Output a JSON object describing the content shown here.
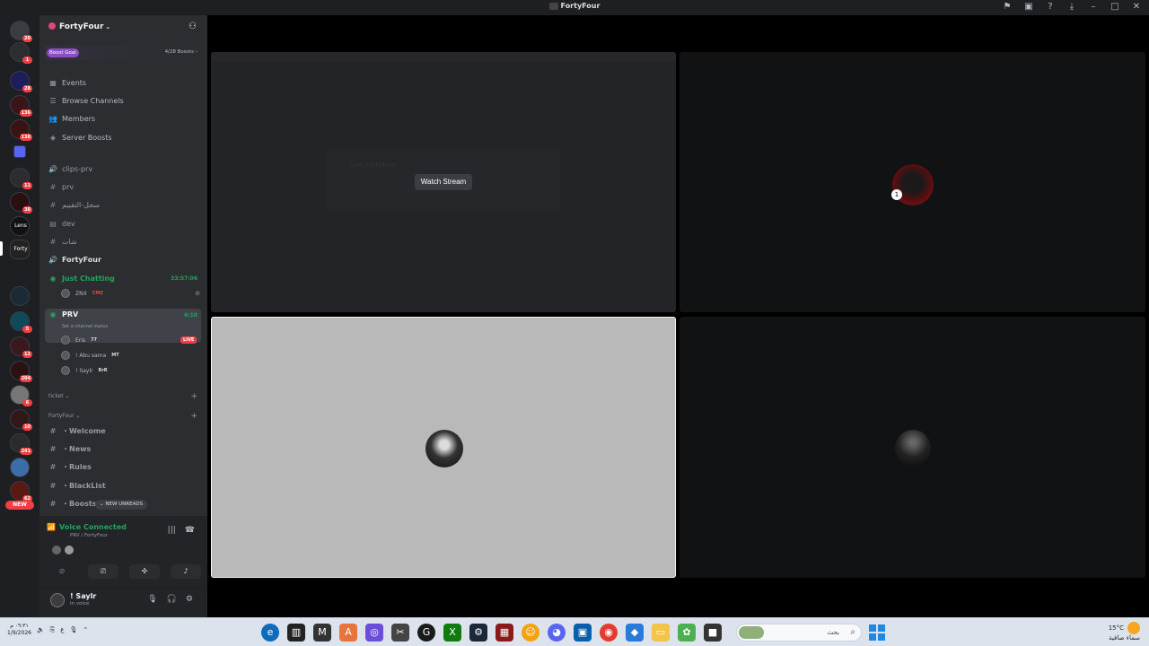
{
  "window": {
    "title": "FortyFour"
  },
  "server": {
    "name": "FortyFour",
    "boost_goal_label": "Boost Goal",
    "boost_count": "4/28 Boosts ›"
  },
  "server_rail": {
    "badges": [
      "20",
      "1",
      "28",
      "136",
      "138",
      "11",
      "38",
      "1",
      "5",
      "12",
      "204",
      "6",
      "10",
      "241",
      "62"
    ],
    "new_label": "NEW",
    "labels": [
      "Lens",
      "Forty"
    ]
  },
  "nav": [
    {
      "label": "Events",
      "icon": "calendar-icon"
    },
    {
      "label": "Browse Channels",
      "icon": "browse-icon"
    },
    {
      "label": "Members",
      "icon": "members-icon"
    },
    {
      "label": "Server Boosts",
      "icon": "boost-icon"
    }
  ],
  "channels": [
    {
      "label": "clips-prv",
      "icon": "speaker-icon"
    },
    {
      "label": "prv",
      "icon": "hash-icon"
    },
    {
      "label": "سجل-التقييم",
      "icon": "hash-icon"
    },
    {
      "label": "dev",
      "icon": "forum-icon"
    },
    {
      "label": "شات",
      "icon": "hash-icon"
    },
    {
      "label": "FortyFour",
      "icon": "speaker-icon"
    }
  ],
  "voice_channels": {
    "just_chatting": {
      "label": "Just Chatting",
      "timer": "33:57:06",
      "users_line": "ZNX",
      "tag": "CMZ"
    },
    "prv": {
      "label": "PRV",
      "timer": "6:10",
      "status": "Set a channel status",
      "users": [
        {
          "name": "Eris",
          "tag": "77",
          "live": "LIVE"
        },
        {
          "name": "! Abu sama",
          "tag": "MT"
        },
        {
          "name": "! Saylr",
          "tag": "RrR"
        }
      ]
    }
  },
  "categories": {
    "ticket": "ticket ⌄",
    "fortyfour": "FortyFour ⌄"
  },
  "text_channels": [
    "・Welcome",
    "・News",
    "・Rules",
    "・BlackList",
    "・Boosts"
  ],
  "new_unreads": "⌄ NEW UNREADS",
  "voice_panel": {
    "status": "Voice Connected",
    "location": "PRV / FortyFour"
  },
  "user": {
    "name": "! Saylr",
    "status": "In voice"
  },
  "stage": {
    "watch_stream_label": "Watch Stream",
    "ghost_title": "Live FortyFour",
    "avatar_number": "1"
  },
  "taskbar": {
    "time": "٠٩:٣١ م",
    "date": "1/9/2026",
    "search_placeholder": "بحث",
    "temperature": "15°C",
    "weather": "سماء صافية"
  },
  "colors": {
    "discord_bg": "#2b2d31",
    "rail_bg": "#1e1f22",
    "voice_green": "#23a55a",
    "live_red": "#f23f43",
    "boost_purple": "#8a4fc2"
  }
}
